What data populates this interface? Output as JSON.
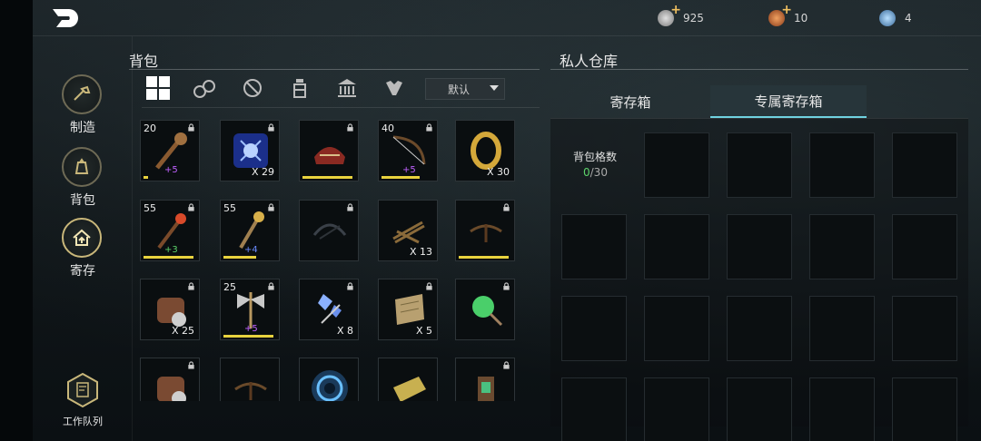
{
  "currencies": [
    {
      "icon": "silver-coin-icon",
      "value": "925",
      "addable": true
    },
    {
      "icon": "gem-token-icon",
      "value": "10",
      "addable": true
    },
    {
      "icon": "crystal-orb-icon",
      "value": "4",
      "addable": false
    }
  ],
  "sidenav": {
    "items": [
      {
        "label": "制造",
        "icon": "crafting-hammer-icon",
        "active": false
      },
      {
        "label": "背包",
        "icon": "bag-icon",
        "active": false
      },
      {
        "label": "寄存",
        "icon": "deposit-house-icon",
        "active": true
      }
    ],
    "work_queue": "工作队列"
  },
  "backpack": {
    "title": "背包",
    "filters": [
      "all-grid-icon",
      "materials-icon",
      "weapon-icon",
      "potion-icon",
      "building-icon",
      "creature-icon"
    ],
    "sort": "默认",
    "slots": [
      {
        "level": "20",
        "lock": true,
        "count": "",
        "bonus": "+5",
        "bonus_color": "#c060ff",
        "bar": 0.08,
        "art": "club-icon"
      },
      {
        "level": "",
        "lock": true,
        "count": "X 29",
        "bonus": "",
        "bar": 0,
        "art": "blue-crystal-icon"
      },
      {
        "level": "",
        "lock": true,
        "count": "",
        "bonus": "",
        "bar": 0.92,
        "art": "red-saddle-icon"
      },
      {
        "level": "40",
        "lock": true,
        "count": "",
        "bonus": "+5",
        "bonus_color": "#c060ff",
        "bar": 0.7,
        "art": "bow-icon"
      },
      {
        "level": "",
        "lock": false,
        "count": "X 30",
        "bonus": "",
        "bar": 0,
        "art": "gold-ring-icon"
      },
      {
        "level": "55",
        "lock": true,
        "count": "",
        "bonus": "+3",
        "bonus_color": "#5cd36a",
        "bar": 0.92,
        "art": "fire-staff-icon"
      },
      {
        "level": "55",
        "lock": true,
        "count": "",
        "bonus": "+4",
        "bonus_color": "#6b8cff",
        "bar": 0.6,
        "art": "ice-staff-icon"
      },
      {
        "level": "",
        "lock": true,
        "count": "",
        "bonus": "",
        "bar": 0,
        "art": "dark-net-icon"
      },
      {
        "level": "",
        "lock": false,
        "count": "X 13",
        "bonus": "",
        "bar": 0,
        "art": "wood-bundle-icon"
      },
      {
        "level": "",
        "lock": true,
        "count": "",
        "bonus": "",
        "bar": 0.92,
        "art": "crossbow-icon"
      },
      {
        "level": "",
        "lock": true,
        "count": "X 25",
        "bonus": "",
        "bar": 0,
        "art": "leather-pouch-icon"
      },
      {
        "level": "25",
        "lock": true,
        "count": "",
        "bonus": "+5",
        "bonus_color": "#c060ff",
        "bar": 0.92,
        "art": "double-axe-icon"
      },
      {
        "level": "",
        "lock": true,
        "count": "X 8",
        "bonus": "",
        "bar": 0,
        "art": "blue-gem-icon"
      },
      {
        "level": "",
        "lock": true,
        "count": "X 5",
        "bonus": "",
        "bar": 0,
        "art": "map-scroll-icon"
      },
      {
        "level": "",
        "lock": true,
        "count": "",
        "bonus": "",
        "bar": 0,
        "art": "green-herb-icon"
      },
      {
        "level": "",
        "lock": true,
        "count": "",
        "bonus": "",
        "bar": 0,
        "art": "leather-pouch-icon"
      },
      {
        "level": "",
        "lock": false,
        "count": "",
        "bonus": "",
        "bar": 0,
        "art": "crossbow-icon"
      },
      {
        "level": "",
        "lock": false,
        "count": "",
        "bonus": "",
        "bar": 0,
        "art": "portal-swirl-icon"
      },
      {
        "level": "",
        "lock": false,
        "count": "",
        "bonus": "",
        "bar": 0,
        "art": "gold-bar-icon"
      },
      {
        "level": "",
        "lock": true,
        "count": "",
        "bonus": "",
        "bar": 0,
        "art": "lantern-icon"
      }
    ]
  },
  "storage": {
    "title": "私人仓库",
    "tabs": [
      {
        "label": "寄存箱",
        "active": false
      },
      {
        "label": "专属寄存箱",
        "active": true
      }
    ],
    "capacity_label": "背包格数",
    "capacity_used": "0",
    "capacity_total": "/30"
  }
}
